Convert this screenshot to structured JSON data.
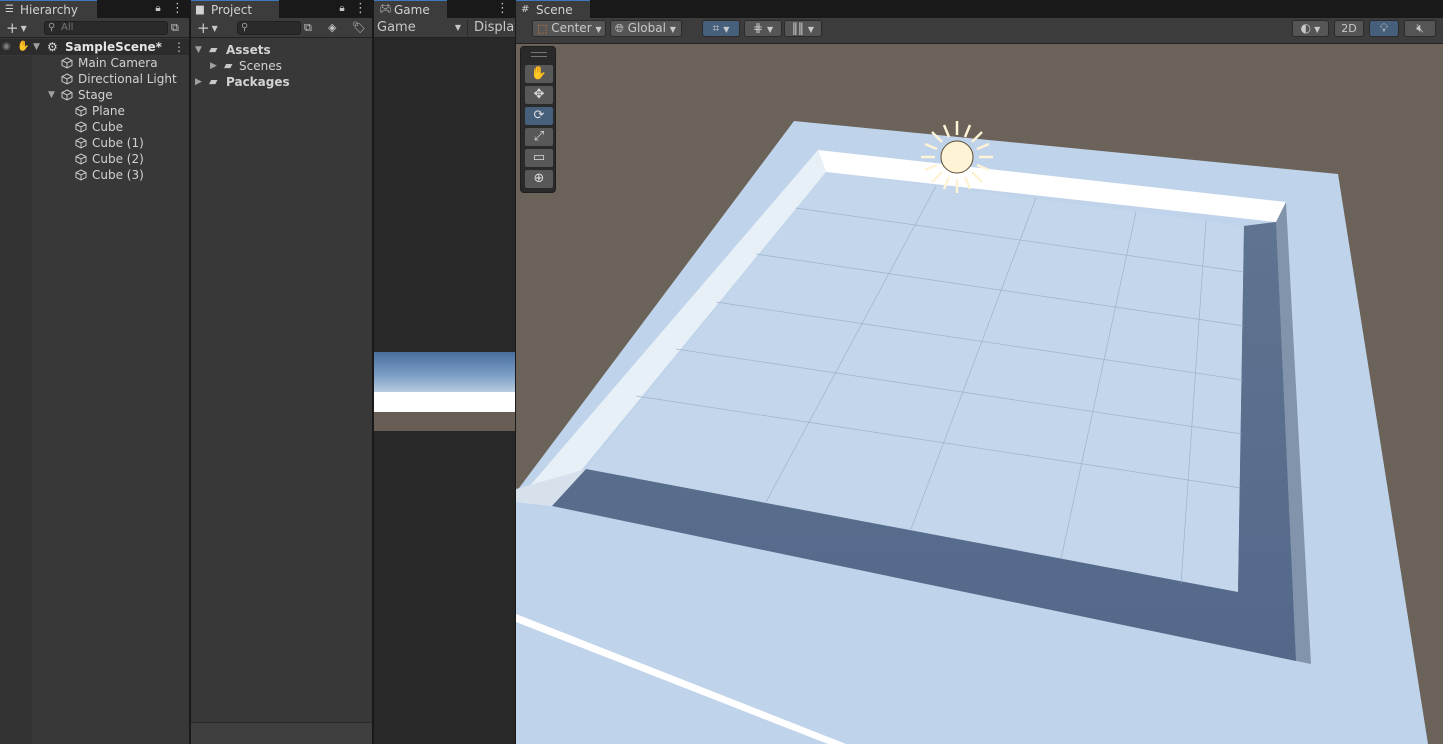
{
  "hierarchy": {
    "tab_label": "Hierarchy",
    "search_placeholder": "All",
    "scene_name": "SampleScene*",
    "items": [
      {
        "label": "Main Camera"
      },
      {
        "label": "Directional Light"
      },
      {
        "label": "Stage"
      },
      {
        "label": "Plane"
      },
      {
        "label": "Cube"
      },
      {
        "label": "Cube (1)"
      },
      {
        "label": "Cube (2)"
      },
      {
        "label": "Cube (3)"
      }
    ]
  },
  "project": {
    "tab_label": "Project",
    "items": [
      {
        "label": "Assets"
      },
      {
        "label": "Scenes"
      },
      {
        "label": "Packages"
      }
    ]
  },
  "game": {
    "tab_label": "Game",
    "mode_dropdown": "Game",
    "display_dropdown": "Display"
  },
  "scene": {
    "tab_label": "Scene",
    "pivot_dropdown": "Center",
    "space_dropdown": "Global",
    "toggle_2d": "2D",
    "tools": [
      {
        "name": "hand-tool",
        "glyph": "✋"
      },
      {
        "name": "move-tool",
        "glyph": "✥"
      },
      {
        "name": "rotate-tool",
        "glyph": "⟳"
      },
      {
        "name": "scale-tool",
        "glyph": "⤢"
      },
      {
        "name": "rect-tool",
        "glyph": "▭"
      },
      {
        "name": "transform-tool",
        "glyph": "⊕"
      }
    ],
    "active_tool": "rotate-tool"
  },
  "colors": {
    "accent": "#3a79bb",
    "panel_bg": "#383838",
    "active_button": "#46607c",
    "ground": "#6b6259",
    "plane": "#bfd3ea"
  }
}
